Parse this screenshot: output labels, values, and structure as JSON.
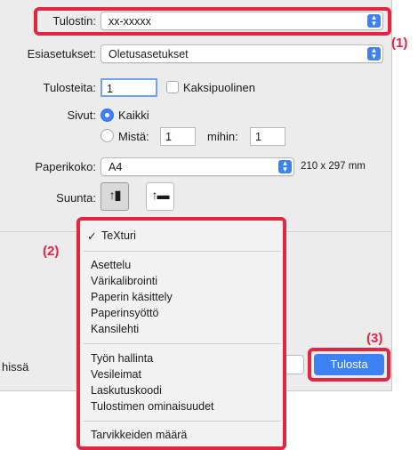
{
  "printer": {
    "label": "Tulostin:",
    "value": "xx-xxxxx"
  },
  "presets": {
    "label": "Esiasetukset:",
    "value": "Oletusasetukset"
  },
  "copies": {
    "label": "Tulosteita:",
    "value": "1",
    "duplex_label": "Kaksipuolinen"
  },
  "pages": {
    "label": "Sivut:",
    "all_label": "Kaikki",
    "from_label": "Mistä:",
    "from_value": "1",
    "to_label": "mihin:",
    "to_value": "1"
  },
  "paper_size": {
    "label": "Paperikoko:",
    "value": "A4",
    "dimensions": "210 x 297 mm"
  },
  "orientation": {
    "label": "Suunta:"
  },
  "menu": {
    "selected_check": "✓",
    "selected": "TeXturi",
    "group1": [
      "Asettelu",
      "Värikalibrointi",
      "Paperin käsittely",
      "Paperinsyöttö",
      "Kansilehti"
    ],
    "group2": [
      "Työn hallinta",
      "Vesileimat",
      "Laskutuskoodi",
      "Tulostimen ominaisuudet"
    ],
    "group3": [
      "Tarvikkeiden määrä"
    ]
  },
  "bottom": {
    "left_text": "hissä",
    "print_button": "Tulosta"
  },
  "callouts": {
    "c1": "(1)",
    "c2": "(2)",
    "c3": "(3)"
  },
  "colors": {
    "callout_red": "#e4253f",
    "accent_blue": "#3d82f5"
  }
}
